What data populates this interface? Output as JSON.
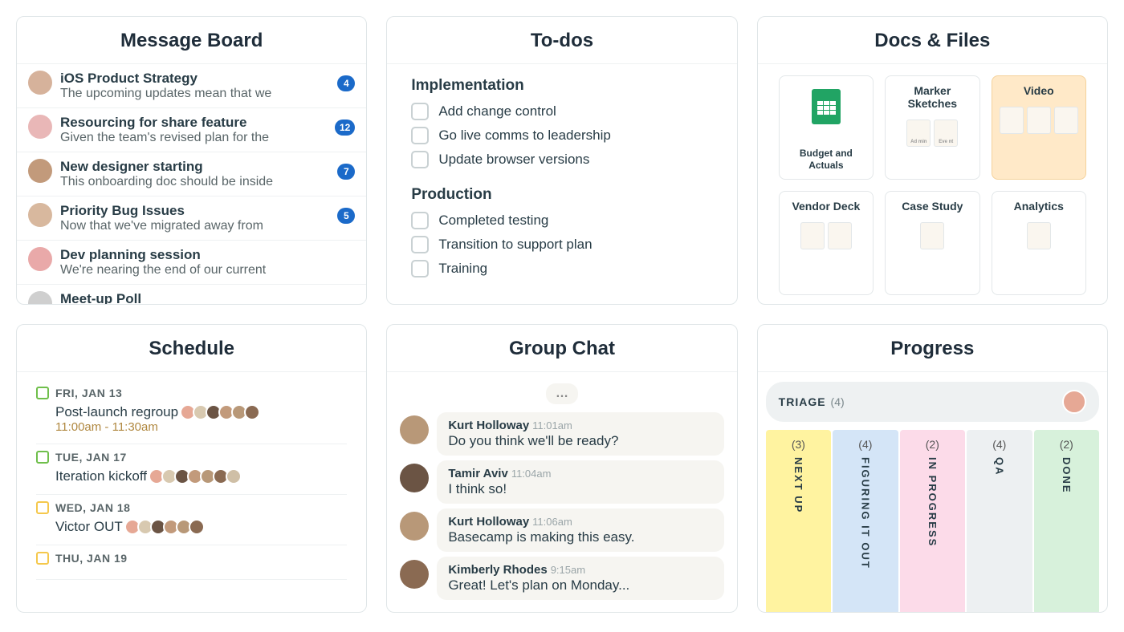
{
  "message_board": {
    "title": "Message Board",
    "items": [
      {
        "title": "iOS Product Strategy",
        "preview": "The upcoming updates mean that we",
        "count": 4,
        "avatar": "#d6b29b"
      },
      {
        "title": "Resourcing for share feature",
        "preview": "Given the team's revised plan for the",
        "count": 12,
        "avatar": "#e9b7b7"
      },
      {
        "title": "New designer starting",
        "preview": "This onboarding doc should be inside",
        "count": 7,
        "avatar": "#c29a7b"
      },
      {
        "title": "Priority Bug Issues",
        "preview": "Now that we've migrated away from",
        "count": 5,
        "avatar": "#d8b89e"
      },
      {
        "title": "Dev planning session",
        "preview": "We're nearing the end of our current",
        "count": null,
        "avatar": "#e9a9a9"
      },
      {
        "title": "Meet-up Poll",
        "preview": "",
        "count": null,
        "avatar": "#cfcfcf"
      }
    ]
  },
  "todos": {
    "title": "To-dos",
    "sections": [
      {
        "heading": "Implementation",
        "items": [
          "Add change control",
          "Go live comms to leadership",
          "Update browser versions"
        ]
      },
      {
        "heading": "Production",
        "items": [
          "Completed testing",
          "Transition to support plan",
          "Training"
        ]
      }
    ]
  },
  "docs": {
    "title": "Docs & Files",
    "tiles": [
      {
        "label": "Budget and Actuals",
        "kind": "sheets"
      },
      {
        "label": "Marker Sketches",
        "kind": "folder",
        "thumbs": [
          "Ad min",
          "Eve nt"
        ]
      },
      {
        "label": "Video",
        "kind": "folder",
        "highlight": true,
        "thumbs": [
          "",
          "",
          ""
        ]
      },
      {
        "label": "Vendor Deck",
        "kind": "folder",
        "thumbs": [
          "",
          ""
        ]
      },
      {
        "label": "Case Study",
        "kind": "folder",
        "thumbs": [
          ""
        ]
      },
      {
        "label": "Analytics",
        "kind": "folder",
        "thumbs": [
          ""
        ]
      }
    ]
  },
  "schedule": {
    "title": "Schedule",
    "events": [
      {
        "date": "FRI, JAN 13",
        "title": "Post-launch regroup",
        "time": "11:00am - 11:30am",
        "attendees": 6,
        "cal": "green"
      },
      {
        "date": "TUE, JAN 17",
        "title": "Iteration kickoff",
        "time": null,
        "attendees": 7,
        "cal": "green"
      },
      {
        "date": "WED, JAN 18",
        "title": "Victor OUT",
        "time": null,
        "attendees": 6,
        "cal": "yellow"
      },
      {
        "date": "THU, JAN 19",
        "title": "",
        "time": null,
        "attendees": 0,
        "cal": "yellow"
      }
    ]
  },
  "chat": {
    "title": "Group Chat",
    "messages": [
      {
        "name": "Kurt Holloway",
        "time": "11:01am",
        "text": "Do you think we'll be ready?",
        "avatar": "#b89878"
      },
      {
        "name": "Tamir Aviv",
        "time": "11:04am",
        "text": "I think so!",
        "avatar": "#6b5444"
      },
      {
        "name": "Kurt Holloway",
        "time": "11:06am",
        "text": "Basecamp is making this easy.",
        "avatar": "#b89878"
      },
      {
        "name": "Kimberly Rhodes",
        "time": "9:15am",
        "text": "Great! Let's plan on Monday...",
        "avatar": "#8a6a52"
      }
    ]
  },
  "progress": {
    "title": "Progress",
    "triage": {
      "label": "TRIAGE",
      "count": "(4)"
    },
    "columns": [
      {
        "name": "NEXT UP",
        "count": "(3)",
        "color": "c-yellow"
      },
      {
        "name": "FIGURING IT OUT",
        "count": "(4)",
        "color": "c-blue"
      },
      {
        "name": "IN PROGRESS",
        "count": "(2)",
        "color": "c-pink"
      },
      {
        "name": "QA",
        "count": "(4)",
        "color": "c-grey"
      },
      {
        "name": "DONE",
        "count": "(2)",
        "color": "c-green"
      }
    ]
  },
  "avatar_palette": [
    "#e6a895",
    "#d8c9b0",
    "#6b5444",
    "#c29a7b",
    "#b89878",
    "#8a6a52",
    "#cfbfa6"
  ]
}
